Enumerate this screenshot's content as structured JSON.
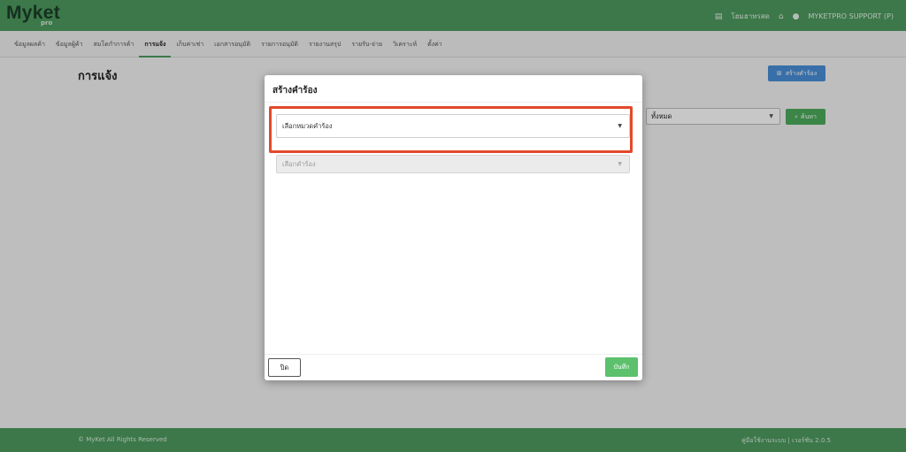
{
  "app": {
    "logo": "Myket",
    "logo_sub": "pro",
    "shop_label": "โฮมฮาทรสด",
    "user_label": "MYKETPRO SUPPORT (P)"
  },
  "nav": {
    "items": [
      {
        "label": "ข้อมูลผลค้า"
      },
      {
        "label": "ข้อมูลผู้ค้า"
      },
      {
        "label": "สมโดกำการค้า"
      },
      {
        "label": "การแจ้ง",
        "active": true
      },
      {
        "label": "เก็บค่าเช่า"
      },
      {
        "label": "เอกสารอนุมัติ"
      },
      {
        "label": "รายการอนุมัติ"
      },
      {
        "label": "รายงานสรุป"
      },
      {
        "label": "รายรับ-จ่าย"
      },
      {
        "label": "วิเคราะห์"
      },
      {
        "label": "ตั้งค่า"
      }
    ]
  },
  "page": {
    "title": "การแจ้ง",
    "create_button": "สร้างคำร้อง",
    "filter_value": "ทั้งหมด",
    "search_button": "ค้นหา"
  },
  "modal": {
    "title": "สร้างคำร้อง",
    "category_placeholder": "เลือกหมวดคำร้อง",
    "request_placeholder": "เลือกคำร้อง",
    "close_button": "ปิด",
    "save_button": "บันทึก"
  },
  "footer": {
    "copyright": "© MyKet All Rights Reserved",
    "right_text": "คู่มือใช้งานระบบ | เวอร์ชัน 2.0.5"
  },
  "colors": {
    "brand_green": "#4e9a5e",
    "primary_blue": "#4a8fd8",
    "highlight_red": "#e2492b",
    "save_green": "#5cc06d"
  }
}
